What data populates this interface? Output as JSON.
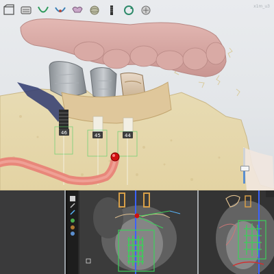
{
  "app": {
    "title_text": "x1m_u3"
  },
  "toolbar": {
    "items": [
      {
        "icon": "cube-box-icon"
      },
      {
        "icon": "arch-jaw-icon"
      },
      {
        "icon": "arch-outline-icon"
      },
      {
        "icon": "implant-arch-icon"
      },
      {
        "icon": "tooth-crown-icon"
      },
      {
        "icon": "single-implant-icon"
      },
      {
        "icon": "rotate-view-icon"
      },
      {
        "icon": "sphere-globe-icon"
      },
      {
        "icon": "view-settings-icon"
      }
    ]
  },
  "implants": {
    "labels": [
      "46",
      "45",
      "44"
    ]
  },
  "slider": {
    "level": 0.45
  },
  "colors": {
    "bone": "#e7d7a8",
    "gingiva": "#d7a9a6",
    "nerve": "#e8877a",
    "red_marker": "#d01010",
    "guide_green": "#3ccf5a",
    "axis_blue": "#3a62ff"
  }
}
